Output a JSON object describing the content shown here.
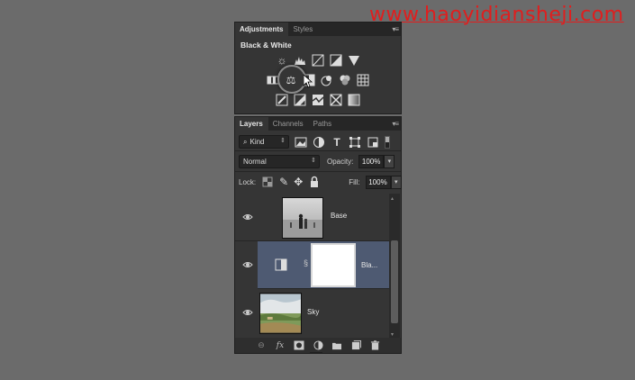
{
  "watermark": "www.haoyidiansheji.com",
  "adjustments_panel": {
    "tabs": [
      {
        "label": "Adjustments",
        "active": true
      },
      {
        "label": "Styles",
        "active": false
      }
    ],
    "title": "Black & White",
    "icon_rows": [
      [
        "brightness-icon",
        "levels-icon",
        "curves-icon",
        "exposure-icon",
        "triangle-icon"
      ],
      [
        "vibrance-icon",
        "color-balance-icon",
        "black-white-icon",
        "photo-filter-icon",
        "channel-mixer-icon",
        "color-lookup-icon"
      ],
      [
        "invert-icon",
        "posterize-icon",
        "threshold-icon",
        "selective-color-icon",
        "gradient-map-icon"
      ]
    ]
  },
  "layers_panel": {
    "tabs": [
      {
        "label": "Layers",
        "active": true
      },
      {
        "label": "Channels",
        "active": false
      },
      {
        "label": "Paths",
        "active": false
      }
    ],
    "filter_kind": "Kind",
    "blend_mode": "Normal",
    "opacity_label": "Opacity:",
    "opacity_value": "100%",
    "lock_label": "Lock:",
    "fill_label": "Fill:",
    "fill_value": "100%",
    "layers": [
      {
        "name": "Base",
        "selected": false
      },
      {
        "name": "Bla...",
        "selected": true
      },
      {
        "name": "Sky",
        "selected": false
      }
    ],
    "bottom_icons": [
      "link-icon",
      "fx-icon",
      "mask-icon",
      "adjustment-icon",
      "folder-icon",
      "new-layer-icon",
      "trash-icon"
    ],
    "fx_label": "fx"
  },
  "colors": {
    "background": "#6b6b6b",
    "panel": "#353535",
    "selected_layer": "#4e5a72",
    "watermark": "#e01e1e"
  }
}
